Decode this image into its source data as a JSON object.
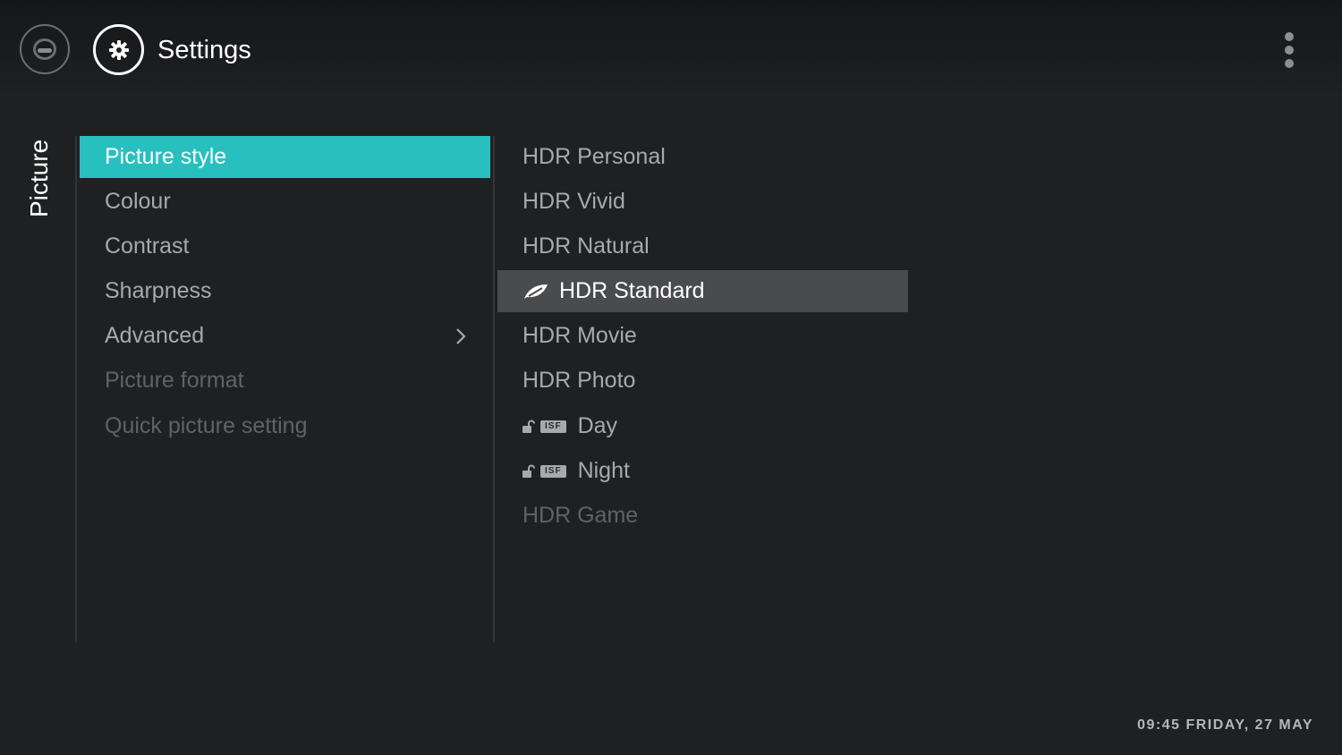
{
  "header": {
    "title": "Settings",
    "icons": {
      "home": "home-icon",
      "settings": "gear-icon",
      "more": "more-vertical-icon"
    }
  },
  "sidebar": {
    "category": "Picture"
  },
  "menu": {
    "items": [
      {
        "label": "Picture style",
        "state": "selected"
      },
      {
        "label": "Colour",
        "state": "normal"
      },
      {
        "label": "Contrast",
        "state": "normal"
      },
      {
        "label": "Sharpness",
        "state": "normal"
      },
      {
        "label": "Advanced",
        "state": "normal",
        "submenu": true
      },
      {
        "label": "Picture format",
        "state": "disabled"
      },
      {
        "label": "Quick picture setting",
        "state": "disabled"
      }
    ]
  },
  "options": {
    "items": [
      {
        "label": "HDR Personal",
        "state": "normal"
      },
      {
        "label": "HDR Vivid",
        "state": "normal"
      },
      {
        "label": "HDR Natural",
        "state": "normal"
      },
      {
        "label": "HDR Standard",
        "state": "active",
        "icon": "leaf-icon"
      },
      {
        "label": "HDR Movie",
        "state": "normal"
      },
      {
        "label": "HDR Photo",
        "state": "normal"
      },
      {
        "label": "Day",
        "state": "normal",
        "badge": "ISF",
        "icon": "unlock-icon"
      },
      {
        "label": "Night",
        "state": "normal",
        "badge": "ISF",
        "icon": "unlock-icon"
      },
      {
        "label": "HDR Game",
        "state": "disabled"
      }
    ]
  },
  "status": {
    "clock": "09:45 FRIDAY, 27 MAY"
  },
  "colors": {
    "accent": "#27c0bf",
    "active_row": "#4a4b4d",
    "background": "#1f2022"
  }
}
